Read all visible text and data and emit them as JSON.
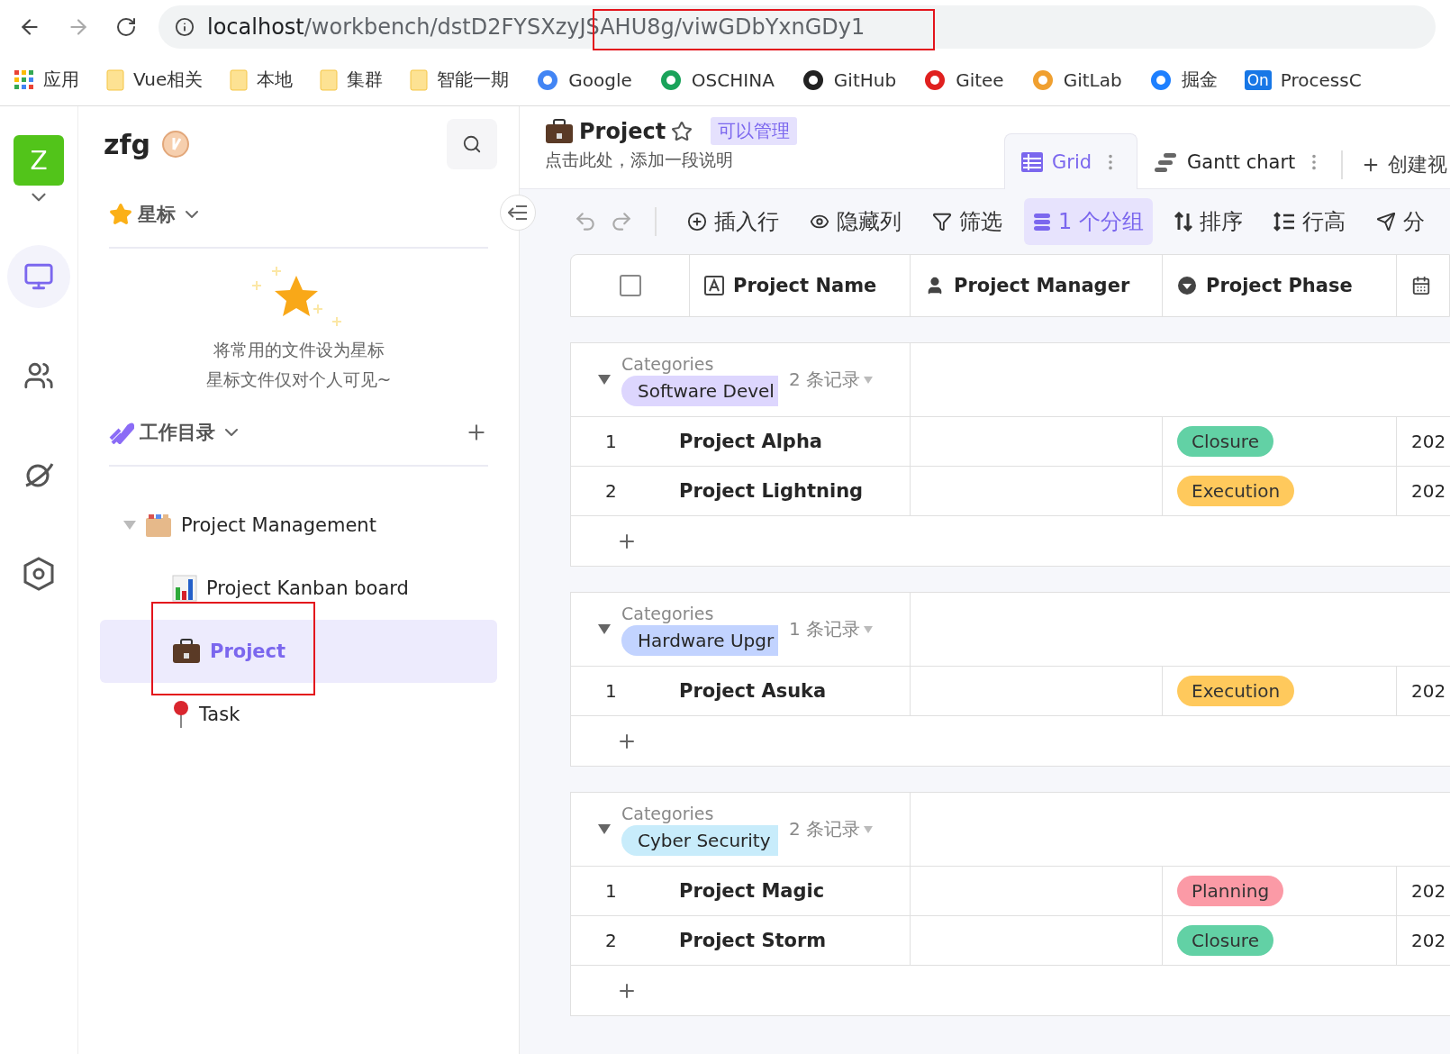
{
  "browser": {
    "url_host": "localhost",
    "url_path": "/workbench/dstD2FYSXzyJSAHU8g/viwGDbYxnGDy1",
    "bookmarks": [
      {
        "label": "应用",
        "kind": "apps"
      },
      {
        "label": "Vue相关",
        "kind": "folder"
      },
      {
        "label": "本地",
        "kind": "folder"
      },
      {
        "label": "集群",
        "kind": "folder"
      },
      {
        "label": "智能一期",
        "kind": "folder"
      },
      {
        "label": "Google",
        "kind": "logo",
        "color": "#4285f4"
      },
      {
        "label": "OSCHINA",
        "kind": "logo",
        "color": "#1aa35a"
      },
      {
        "label": "GitHub",
        "kind": "logo",
        "color": "#222222"
      },
      {
        "label": "Gitee",
        "kind": "logo",
        "color": "#e0201f"
      },
      {
        "label": "GitLab",
        "kind": "logo",
        "color": "#f0a030"
      },
      {
        "label": "掘金",
        "kind": "logo",
        "color": "#1e80ff"
      },
      {
        "label": "ProcessC",
        "kind": "badge",
        "badge": "On",
        "color": "#1777e6"
      }
    ]
  },
  "rail": {
    "avatar": "Z",
    "items": [
      {
        "kind": "monitor",
        "selected": true
      },
      {
        "kind": "people",
        "selected": false
      },
      {
        "kind": "planet",
        "selected": false
      },
      {
        "kind": "settings",
        "selected": false
      }
    ]
  },
  "sidebar": {
    "space_name": "zfg",
    "starred": {
      "title": "星标",
      "empty_lines": [
        "将常用的文件设为星标",
        "星标文件仅对个人可见~"
      ]
    },
    "workspace": {
      "title": "工作目录",
      "tree": [
        {
          "label": "Project Management",
          "kind": "folder",
          "expanded": true,
          "selected": false,
          "children": [
            {
              "label": "Project Kanban board",
              "kind": "chart",
              "selected": false
            },
            {
              "label": "Project",
              "kind": "briefcase",
              "selected": true
            },
            {
              "label": "Task",
              "kind": "pin",
              "selected": false
            }
          ]
        }
      ]
    }
  },
  "main": {
    "title": "Project",
    "permission": "可以管理",
    "description": "点击此处，添加一段说明",
    "views": [
      {
        "label": "Grid",
        "kind": "grid",
        "selected": true
      },
      {
        "label": "Gantt chart",
        "kind": "gantt",
        "selected": false
      }
    ],
    "create_view": "创建视",
    "toolbar": [
      {
        "label": "插入行",
        "kind": "plus",
        "selected": false
      },
      {
        "label": "隐藏列",
        "kind": "eye",
        "selected": false
      },
      {
        "label": "筛选",
        "kind": "filter",
        "selected": false
      },
      {
        "label": "1 个分组",
        "kind": "group",
        "selected": true
      },
      {
        "label": "排序",
        "kind": "sort",
        "selected": false
      },
      {
        "label": "行高",
        "kind": "height",
        "selected": false
      },
      {
        "label": "分",
        "kind": "share",
        "selected": false
      }
    ],
    "table": {
      "select_all": {
        "checked": false
      },
      "columns": [
        {
          "label": "Project Name",
          "kind": "text"
        },
        {
          "label": "Project Manager",
          "kind": "person"
        },
        {
          "label": "Project Phase",
          "kind": "select"
        },
        {
          "kind": "date"
        }
      ],
      "groups": [
        {
          "field": "Categories",
          "value": "Software Devel",
          "color": "#ddd6fe",
          "count": "2 条记录",
          "expanded": true,
          "rows": [
            {
              "index": "1",
              "name": "Project Alpha",
              "phase": {
                "label": "Closure",
                "color": "#62d1a5"
              },
              "column_4": "202"
            },
            {
              "index": "2",
              "name": "Project Lightning",
              "phase": {
                "label": "Execution",
                "color": "#ffc95c"
              },
              "column_4": "202"
            }
          ]
        },
        {
          "field": "Categories",
          "value": "Hardware Upgr",
          "color": "#c2d3ff",
          "count": "1 条记录",
          "expanded": true,
          "rows": [
            {
              "index": "1",
              "name": "Project Asuka",
              "phase": {
                "label": "Execution",
                "color": "#ffc95c"
              },
              "column_4": "202"
            }
          ]
        },
        {
          "field": "Categories",
          "value": "Cyber Security",
          "color": "#c8ecfb",
          "count": "2 条记录",
          "expanded": true,
          "rows": [
            {
              "index": "1",
              "name": "Project Magic",
              "phase": {
                "label": "Planning",
                "color": "#fb9aa6"
              },
              "column_4": "202"
            },
            {
              "index": "2",
              "name": "Project Storm",
              "phase": {
                "label": "Closure",
                "color": "#62d1a5"
              },
              "column_4": "202"
            }
          ]
        }
      ]
    }
  }
}
